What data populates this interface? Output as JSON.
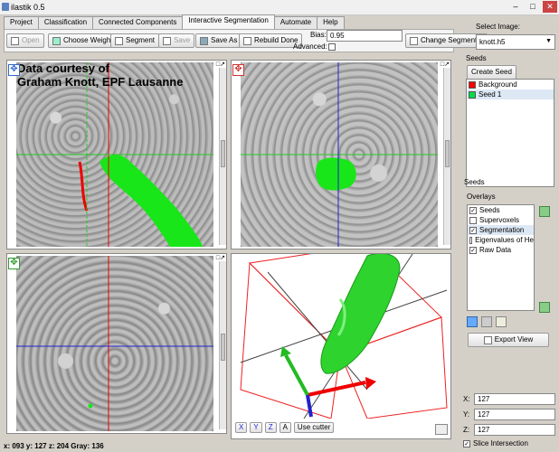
{
  "window": {
    "title": "ilastik 0.5"
  },
  "tabs": [
    "Project",
    "Classification",
    "Connected Components",
    "Interactive Segmentation",
    "Automate",
    "Help"
  ],
  "toolbar": {
    "open": "Open",
    "choose_weights": "Choose Weights",
    "segment": "Segment",
    "save": "Save",
    "save_as": "Save As",
    "rebuild_done": "Rebuild Done",
    "bias_label": "Bias:",
    "bias_value": "0.95",
    "advanced_label": "Advanced:",
    "change_segmentor": "Change Segmentor"
  },
  "select_image": {
    "label": "Select Image:",
    "value": "knott.h5"
  },
  "seeds": {
    "group_label": "Seeds",
    "create_seed": "Create Seed",
    "items": [
      {
        "label": "Background",
        "color": "#ff0000"
      },
      {
        "label": "Seed 1",
        "color": "#00dd44"
      }
    ],
    "section_label": "Seeds"
  },
  "overlays": {
    "label": "Overlays",
    "items": [
      {
        "label": "Seeds",
        "checked": true
      },
      {
        "label": "Supervoxels",
        "checked": false
      },
      {
        "label": "Segmentation",
        "checked": true
      },
      {
        "label": "Eigenvalues of He",
        "checked": false
      },
      {
        "label": "Raw Data",
        "checked": true
      }
    ],
    "export_view": "Export View"
  },
  "coords": {
    "x_label": "X:",
    "x_value": "127",
    "y_label": "Y:",
    "y_value": "127",
    "z_label": "Z:",
    "z_value": "127"
  },
  "slice_intersection": {
    "label": "Slice Intersection",
    "checked": true
  },
  "viewer": {
    "courtesy_line1": "Data courtesy of",
    "courtesy_line2": "Graham Knott, EPF Lausanne",
    "view3d_buttons": [
      "X",
      "Y",
      "Z",
      "A"
    ],
    "use_cutter": "Use cutter"
  },
  "status": {
    "text": "x: 093  y: 127  z: 204  Gray: 136"
  }
}
